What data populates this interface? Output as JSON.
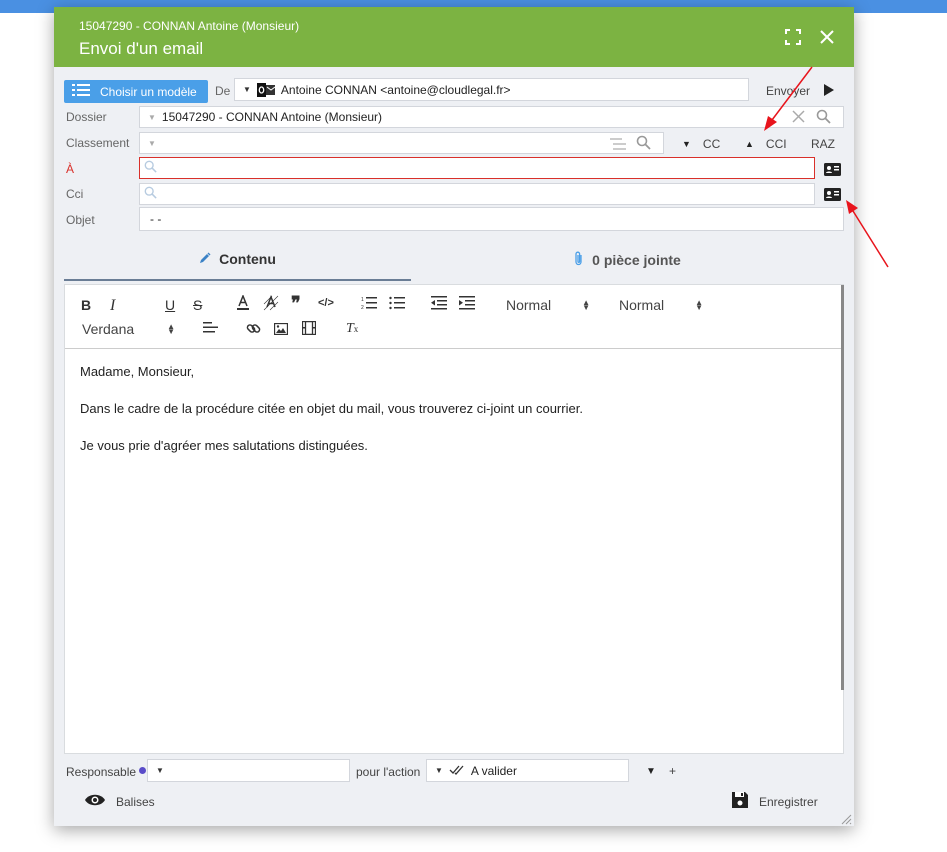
{
  "window": {
    "subtitle": "15047290 - CONNAN Antoine (Monsieur)",
    "title": "Envoi d'un email"
  },
  "toolbar": {
    "choose_template": "Choisir un modèle",
    "from_label": "De",
    "from_value": "Antoine CONNAN <antoine@cloudlegal.fr>",
    "send_label": "Envoyer"
  },
  "form": {
    "dossier_label": "Dossier",
    "dossier_value": "15047290 - CONNAN Antoine (Monsieur)",
    "classement_label": "Classement",
    "cc_label": "CC",
    "cci_label": "CCI",
    "raz_label": "RAZ",
    "to_label": "À",
    "bcc_label": "Cci",
    "subject_label": "Objet",
    "subject_value": "- -"
  },
  "tabs": {
    "content": "Contenu",
    "attachments": "0 pièce jointe"
  },
  "editor": {
    "header_style": "Normal",
    "size_style": "Normal",
    "font": "Verdana",
    "paragraphs": [
      "Madame, Monsieur,",
      "Dans le cadre de la procédure citée en objet du mail, vous trouverez ci-joint un courrier.",
      "Je vous prie d'agréer mes salutations distinguées."
    ]
  },
  "footer": {
    "responsible_label": "Responsable",
    "action_label": "pour l'action",
    "action_value": "A valider",
    "plus": "+",
    "tags_label": "Balises",
    "save_label": "Enregistrer"
  },
  "colors": {
    "header_green": "#7cb342",
    "accent_blue": "#4a9fe8",
    "required_red": "#d9302a",
    "annotation_red": "#e8141c"
  }
}
